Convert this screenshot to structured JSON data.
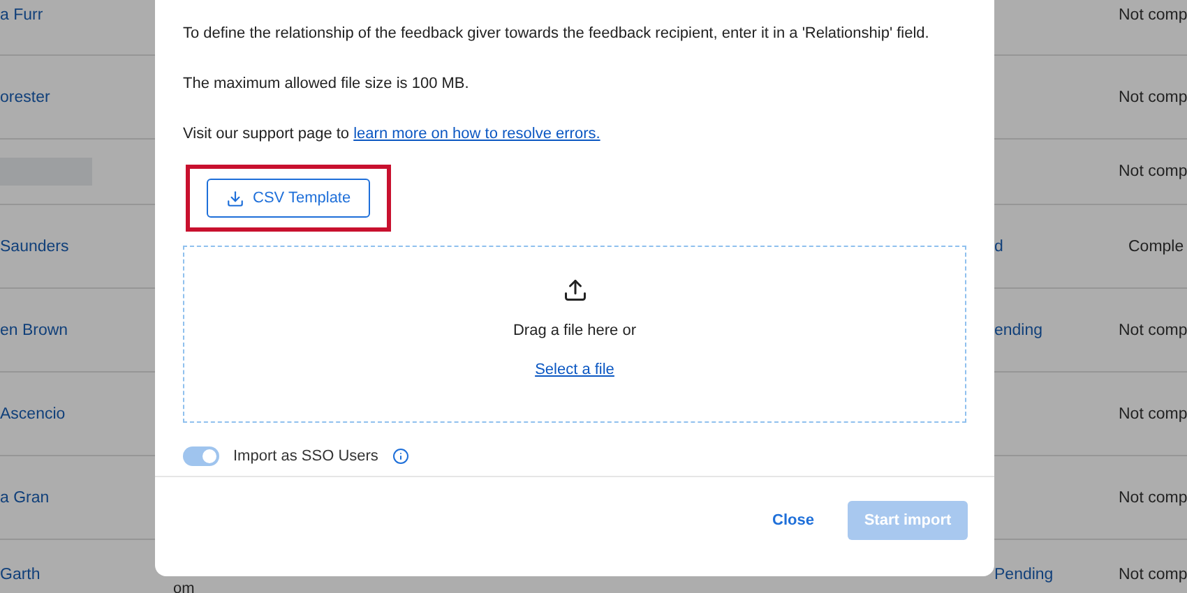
{
  "background_table": {
    "rows": [
      {
        "kind": "name",
        "name": "a Furr",
        "status": "Not comp"
      },
      {
        "kind": "name",
        "name": "orester",
        "status": "Not comp"
      },
      {
        "kind": "loading",
        "status": "Not comp"
      },
      {
        "kind": "name",
        "name": "Saunders",
        "column_2": "d",
        "status": "Comple"
      },
      {
        "kind": "name",
        "name": "en Brown",
        "column_2": "ending",
        "status": "Not comp"
      },
      {
        "kind": "name",
        "name": "Ascencio",
        "status": "Not comp"
      },
      {
        "kind": "name",
        "name": "a Gran",
        "status": "Not comp"
      },
      {
        "kind": "name",
        "name": "Garth",
        "sub": "om",
        "column_2": "Pending",
        "status": "Not comp"
      }
    ]
  },
  "modal": {
    "paragraphs": [
      {
        "text": "To define the relationship of the feedback giver towards the feedback recipient, enter it in a 'Relationship' field."
      },
      {
        "text": "The maximum allowed file size is 100 MB."
      },
      {
        "text": "Visit our support page to ",
        "link": "learn more on how to resolve errors."
      }
    ],
    "template_button": {
      "label": "CSV Template",
      "highlighted": true
    },
    "dropzone": {
      "text": "Drag a file here or",
      "link": "Select a file"
    },
    "toggle": {
      "label": "Import as SSO Users",
      "on": true
    },
    "close_button": {
      "label": "Close"
    },
    "start_button": {
      "label": "Start import",
      "disabled": true
    }
  }
}
